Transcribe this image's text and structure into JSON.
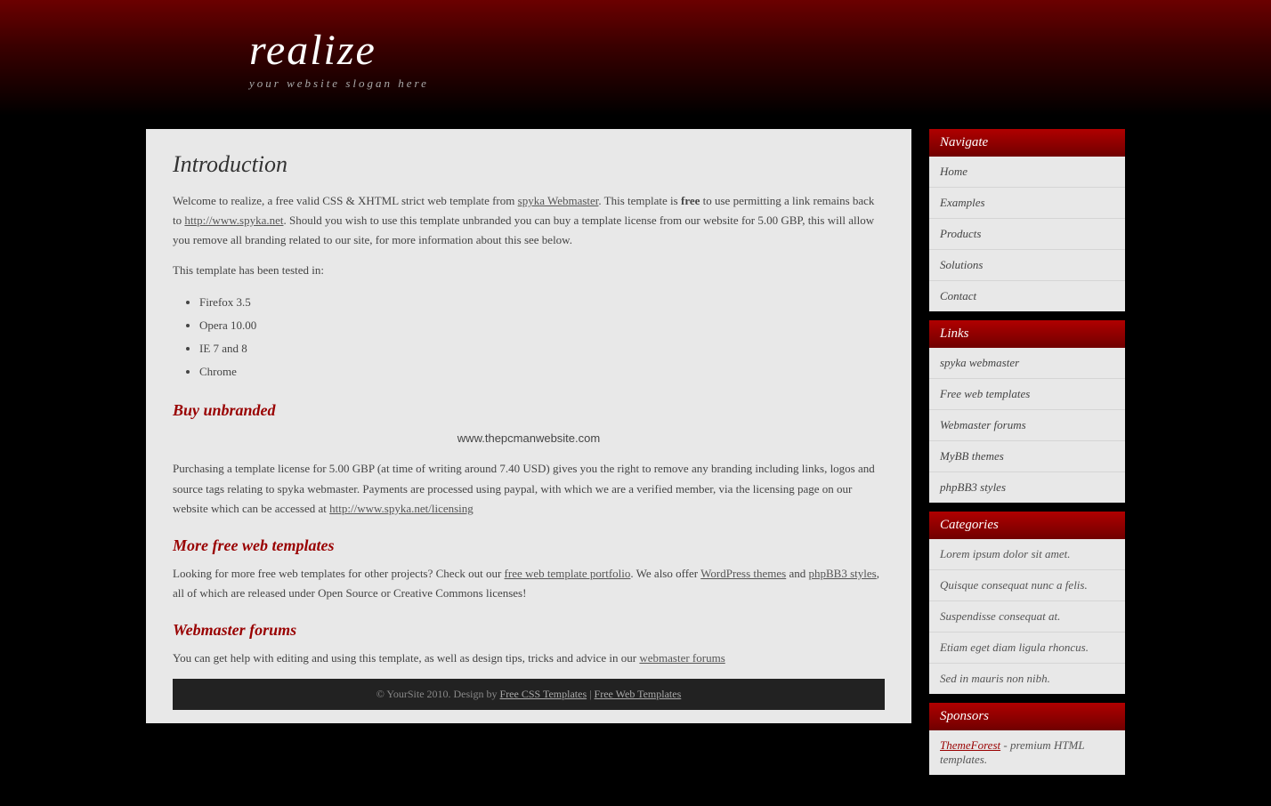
{
  "site": {
    "title": "realize",
    "slogan": "your website slogan here"
  },
  "main": {
    "intro_heading": "Introduction",
    "intro_p1_before_link": "Welcome to realize, a free valid CSS & XHTML strict web template from ",
    "intro_p1_link_text": "spyka Webmaster",
    "intro_p1_link_href": "#",
    "intro_p1_after_link": ". This template is",
    "intro_p1_bold": "free",
    "intro_p2_before_link": " to use permitting a link remains back to ",
    "intro_p2_link_text": "http://www.spyka.net",
    "intro_p2_link_href": "#",
    "intro_p2_after": ". Should you wish to use this template unbranded you can buy a template license from our website for 5.00 GBP, this will allow you remove all branding related to our site, for more information about this see below.",
    "tested_heading": "This template has been tested in:",
    "browser_list": [
      "Firefox 3.5",
      "Opera 10.00",
      "IE 7 and 8",
      "Chrome"
    ],
    "buy_heading": "Buy unbranded",
    "watermark": "www.thepcmanwebsite.com",
    "buy_p": "Purchasing a template license for 5.00 GBP (at time of writing around 7.40 USD) gives you the right to remove any branding including links, logos and source tags relating to spyka webmaster. Payments are processed using paypal, with which we are a verified member, via the licensing page on our website which can be accessed at ",
    "buy_link_text": "http://www.spyka.net/licensing",
    "buy_link_href": "#",
    "more_heading": "More free web templates",
    "more_p_before_link": "Looking for more free web templates for other projects? Check out our ",
    "more_p_link1_text": "free web template portfolio",
    "more_p_link1_href": "#",
    "more_p_middle": ". We also offer ",
    "more_p_link2_text": "WordPress themes",
    "more_p_link2_href": "#",
    "more_p_and": " and ",
    "more_p_link3_text": "phpBB3 styles",
    "more_p_link3_href": "#",
    "more_p_end": ", all of which are released under Open Source or Creative Commons licenses!",
    "webmaster_heading": "Webmaster forums",
    "webmaster_p_before_link": "You can get help with editing and using this template, as well as design tips, tricks and advice in our ",
    "webmaster_link_text": "webmaster forums",
    "webmaster_link_href": "#",
    "footer_text": "© YourSite 2010. Design by ",
    "footer_link1_text": "Free CSS Templates",
    "footer_link1_href": "#",
    "footer_sep": " | ",
    "footer_link2_text": "Free Web Templates",
    "footer_link2_href": "#"
  },
  "sidebar": {
    "navigate_heading": "Navigate",
    "nav_items": [
      {
        "label": "Home",
        "href": "#"
      },
      {
        "label": "Examples",
        "href": "#"
      },
      {
        "label": "Products",
        "href": "#"
      },
      {
        "label": "Solutions",
        "href": "#"
      },
      {
        "label": "Contact",
        "href": "#"
      }
    ],
    "links_heading": "Links",
    "links_items": [
      {
        "label": "spyka webmaster",
        "href": "#"
      },
      {
        "label": "Free web templates",
        "href": "#"
      },
      {
        "label": "Webmaster forums",
        "href": "#"
      },
      {
        "label": "MyBB themes",
        "href": "#"
      },
      {
        "label": "phpBB3 styles",
        "href": "#"
      }
    ],
    "categories_heading": "Categories",
    "categories_items": [
      {
        "label": "Lorem ipsum dolor sit amet."
      },
      {
        "label": "Quisque consequat nunc a felis."
      },
      {
        "label": "Suspendisse consequat at."
      },
      {
        "label": "Etiam eget diam ligula rhoncus."
      },
      {
        "label": "Sed in mauris non nibh."
      }
    ],
    "sponsors_heading": "Sponsors",
    "sponsors_items": [
      {
        "label": "ThemeForest",
        "link_text": "- premium HTML templates."
      }
    ]
  }
}
